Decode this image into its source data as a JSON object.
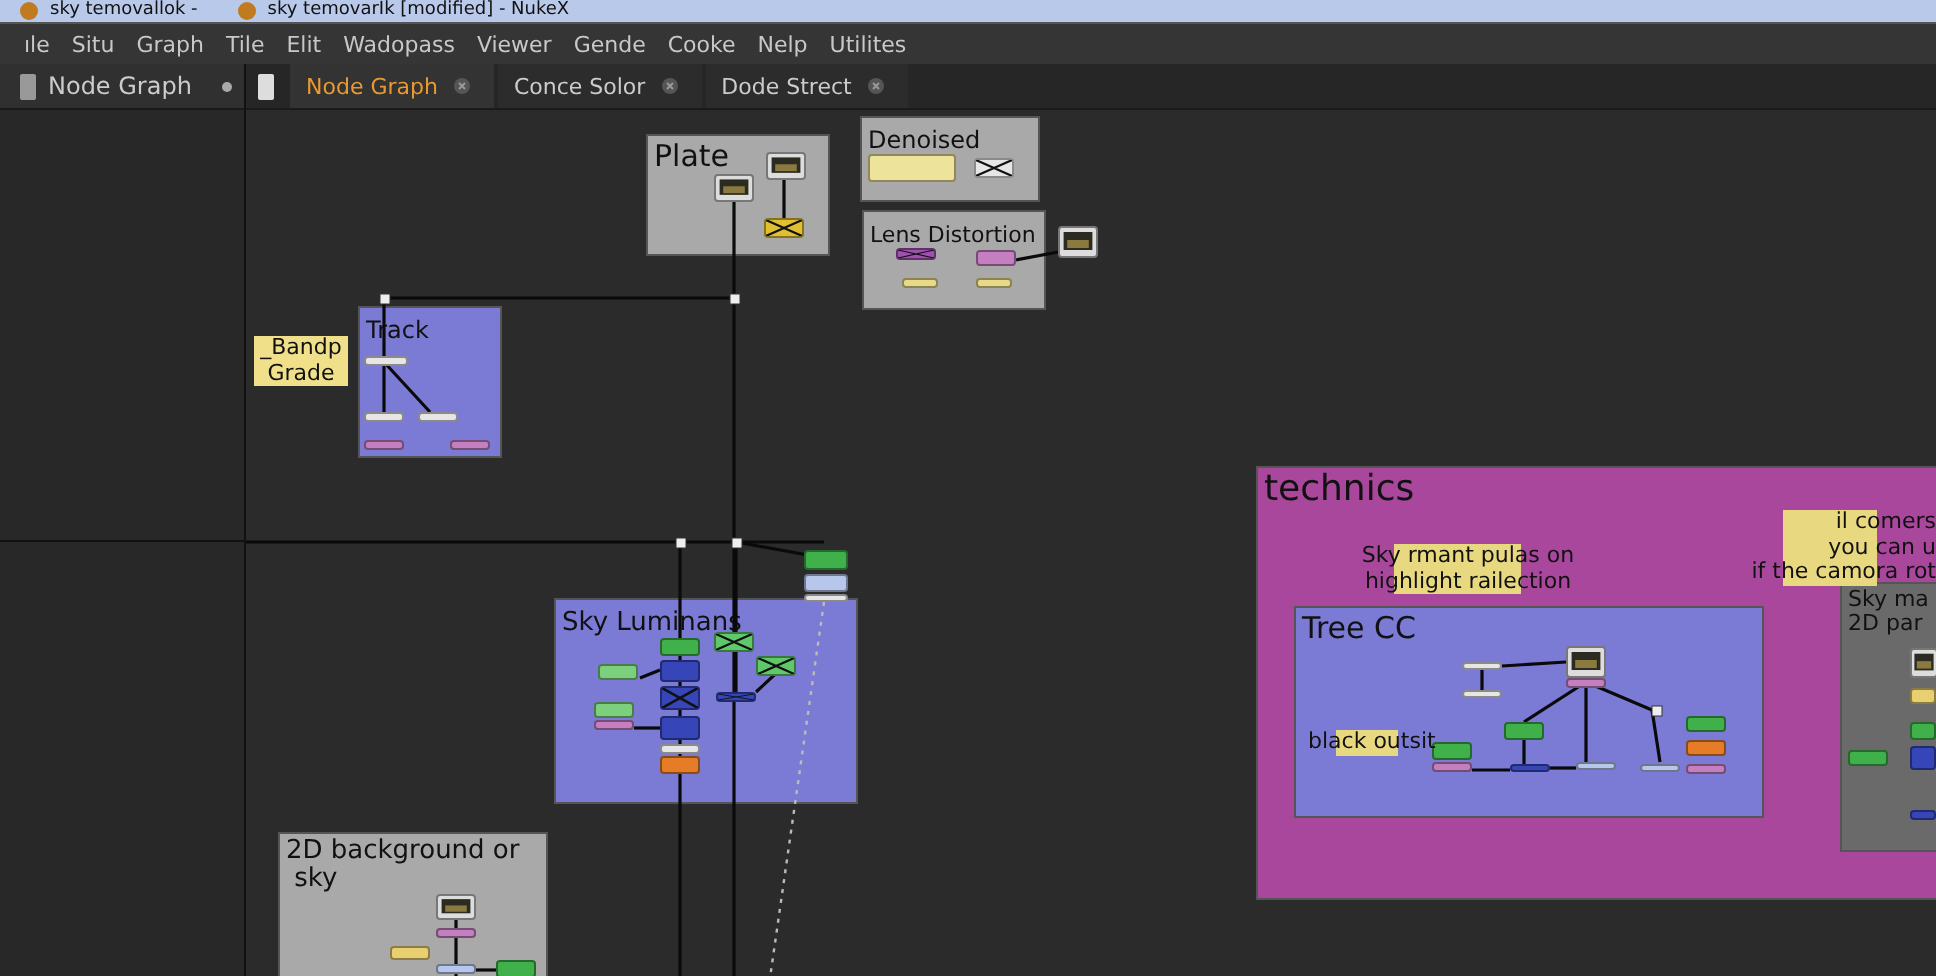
{
  "window": {
    "title_left": "sky temovallok -",
    "title": "sky temovarIk [modified] - NukeX"
  },
  "menu": [
    "ıle",
    "Situ",
    "Graph",
    "Tile",
    "Elit",
    "Wadopass",
    "Viewer",
    "Gende",
    "Cooke",
    "Nelp",
    "Utilites"
  ],
  "side_panel": {
    "title": "Node Graph"
  },
  "tabs": [
    {
      "label": "Node Graph",
      "selected": true
    },
    {
      "label": "Conce Solor",
      "selected": false
    },
    {
      "label": "Dode Strect",
      "selected": false
    }
  ],
  "backdrops": [
    {
      "label": "Plate",
      "color": "#a9a9a9"
    },
    {
      "label": "Denoised",
      "color": "#a9a9a9"
    },
    {
      "label": "Lens Distortion",
      "color": "#a9a9a9"
    },
    {
      "label": "Track",
      "color": "#7b7bd6"
    },
    {
      "label": "Sky Luminans",
      "color": "#7b7bd6"
    },
    {
      "label": "technics",
      "color": "#a8479c"
    },
    {
      "label": "Tree CC",
      "color": "#7b7bd6"
    },
    {
      "label": "Sky ma\n2D par",
      "color": "#6a6a6a"
    },
    {
      "label": "2D background or\n sky",
      "color": "#a9a9a9"
    }
  ],
  "notes": [
    "_Bandp\nGrade",
    "Sky rmant pulas on\nhighlight railection",
    "black outsit",
    "il comers\nyou can u\nif the camora rot"
  ],
  "nodes": [
    {
      "kind": "viewer"
    },
    {
      "kind": "viewer"
    },
    {
      "kind": "disabled",
      "color": "#e0c030"
    },
    {
      "kind": "plain",
      "color": "#eee39a"
    },
    {
      "kind": "disabled",
      "color": "#e6e6e6"
    },
    {
      "kind": "disabled",
      "color": "#a050b0"
    },
    {
      "kind": "plain",
      "color": "#c47fc0"
    },
    {
      "kind": "plain",
      "color": "#e8da88"
    },
    {
      "kind": "plain",
      "color": "#e8da88"
    },
    {
      "kind": "viewer"
    },
    {
      "kind": "plain",
      "color": "#e6e6e6"
    },
    {
      "kind": "plain",
      "color": "#e6e6e6"
    },
    {
      "kind": "plain",
      "color": "#e6e6e6"
    },
    {
      "kind": "plain",
      "color": "#c47fc0"
    },
    {
      "kind": "plain",
      "color": "#c47fc0"
    },
    {
      "kind": "plain",
      "color": "#3fb04a"
    },
    {
      "kind": "plain",
      "color": "#b7c7ec"
    },
    {
      "kind": "plain",
      "color": "#e6e6e6"
    },
    {
      "kind": "plain",
      "color": "#3fb04a"
    },
    {
      "kind": "plain",
      "color": "#3646b8"
    },
    {
      "kind": "disabled",
      "color": "#3646b8"
    },
    {
      "kind": "plain",
      "color": "#3646b8"
    },
    {
      "kind": "plain",
      "color": "#e6e6e6"
    },
    {
      "kind": "plain",
      "color": "#e57d28"
    },
    {
      "kind": "plain",
      "color": "#7ccf7c"
    },
    {
      "kind": "plain",
      "color": "#7ccf7c"
    },
    {
      "kind": "plain",
      "color": "#c47fc0"
    },
    {
      "kind": "disabled",
      "color": "#5ec86a"
    },
    {
      "kind": "disabled",
      "color": "#5ec86a"
    },
    {
      "kind": "disabled",
      "color": "#3646b8"
    },
    {
      "kind": "viewer"
    },
    {
      "kind": "plain",
      "color": "#c47fc0"
    },
    {
      "kind": "plain",
      "color": "#e8d070"
    },
    {
      "kind": "plain",
      "color": "#b7c7ec"
    },
    {
      "kind": "plain",
      "color": "#3fb04a"
    },
    {
      "kind": "viewer"
    },
    {
      "kind": "plain",
      "color": "#c47fc0"
    },
    {
      "kind": "plain",
      "color": "#e6e6e6"
    },
    {
      "kind": "plain",
      "color": "#e6e6e6"
    },
    {
      "kind": "plain",
      "color": "#3fb04a"
    },
    {
      "kind": "plain",
      "color": "#3646b8"
    },
    {
      "kind": "plain",
      "color": "#b7c7ec"
    },
    {
      "kind": "plain",
      "color": "#b7c7ec"
    },
    {
      "kind": "plain",
      "color": "#3fb04a"
    },
    {
      "kind": "plain",
      "color": "#c47fc0"
    },
    {
      "kind": "plain",
      "color": "#3fb04a"
    },
    {
      "kind": "plain",
      "color": "#e57d28"
    },
    {
      "kind": "plain",
      "color": "#c47fc0"
    },
    {
      "kind": "viewer"
    },
    {
      "kind": "plain",
      "color": "#e8d070"
    },
    {
      "kind": "plain",
      "color": "#3fb04a"
    },
    {
      "kind": "plain",
      "color": "#3646b8"
    },
    {
      "kind": "plain",
      "color": "#3fb04a"
    },
    {
      "kind": "plain",
      "color": "#3646b8"
    }
  ]
}
